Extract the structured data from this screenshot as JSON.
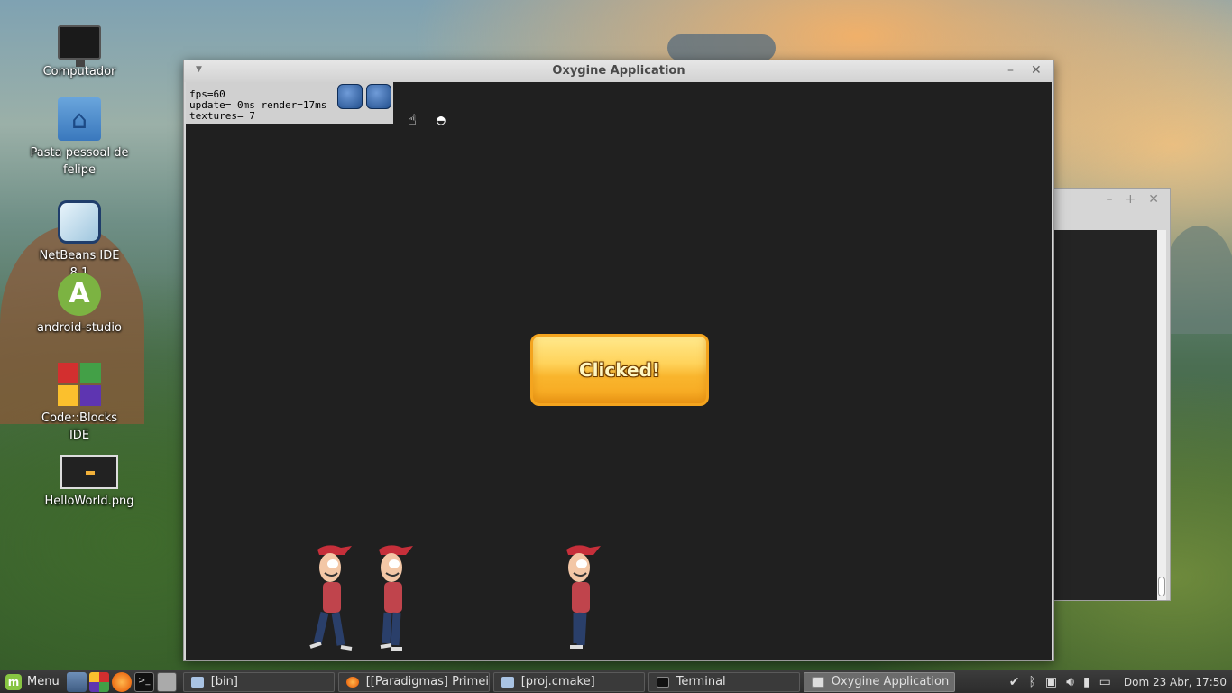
{
  "desktop": {
    "icons": [
      {
        "label": "Computador"
      },
      {
        "label": "Pasta pessoal de felipe"
      },
      {
        "label": "NetBeans IDE 8.1"
      },
      {
        "label": "android-studio"
      },
      {
        "label": "Code::Blocks IDE"
      },
      {
        "label": "HelloWorld.png"
      }
    ]
  },
  "window": {
    "title": "Oxygine Application",
    "minimize": "–",
    "close": "✕",
    "menu": "▼"
  },
  "bg_window": {
    "minimize": "–",
    "maximize": "+",
    "close": "✕"
  },
  "stats": {
    "fps": "fps=60",
    "update": "update= 0ms render=17ms",
    "textures": "textures= 7"
  },
  "game": {
    "button_label": "Clicked!"
  },
  "taskbar": {
    "menu_label": "Menu",
    "tasks": [
      {
        "label": "[bin]"
      },
      {
        "label": "[[Paradigmas] Primei..."
      },
      {
        "label": "[proj.cmake]"
      },
      {
        "label": "Terminal"
      },
      {
        "label": "Oxygine Application"
      }
    ],
    "clock": "Dom 23 Abr, 17:50"
  },
  "colors": {
    "button_orange": "#f9b52d",
    "canvas_bg": "#202020",
    "character_cap": "#c62f3a"
  }
}
